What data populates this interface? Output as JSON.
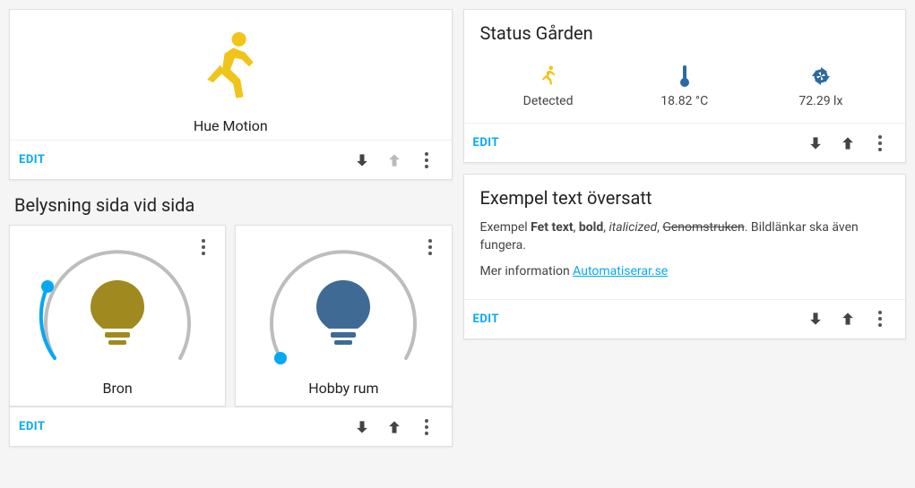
{
  "edit_label": "EDIT",
  "motion_card": {
    "caption": "Hue Motion"
  },
  "status_card": {
    "title": "Status Gården",
    "items": [
      {
        "label": "Detected",
        "icon": "run",
        "color": "#f0c419"
      },
      {
        "label": "18.82 °C",
        "icon": "thermo",
        "color": "#2c6aa0"
      },
      {
        "label": "72.29 lx",
        "icon": "sun",
        "color": "#2c6aa0"
      }
    ]
  },
  "lights_section": {
    "title": "Belysning sida vid sida",
    "lights": [
      {
        "name": "Bron",
        "color": "#a08a1f",
        "arc_color": "#03a9f4",
        "arc_amount": 0.2
      },
      {
        "name": "Hobby rum",
        "color": "#3f6a94",
        "arc_color": "#bdbdbd",
        "arc_amount": 0.0
      }
    ]
  },
  "example_card": {
    "title": "Exempel text översatt",
    "text_pre": "Exempel ",
    "bold1": "Fet text",
    "comma1": ", ",
    "bold2": "bold",
    "comma2": ", ",
    "italic": "italicized",
    "comma3": ", ",
    "strike": "Genomstruken",
    "text_post": ". Bildlänkar ska även fungera.",
    "more_pre": "Mer information ",
    "link": "Automatiserar.se"
  }
}
